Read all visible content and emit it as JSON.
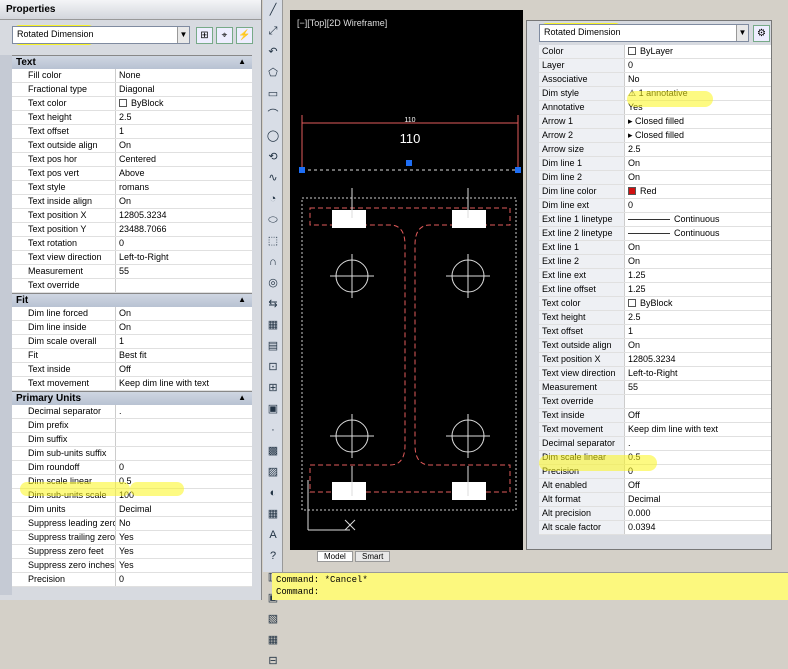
{
  "left_panel": {
    "title": "Properties",
    "combo": "Rotated Dimension",
    "sections": [
      {
        "name": "Text",
        "rows": [
          [
            "Fill color",
            "None"
          ],
          [
            "Fractional type",
            "Diagonal"
          ],
          [
            "Text color",
            "ByBlock"
          ],
          [
            "Text height",
            "2.5"
          ],
          [
            "Text offset",
            "1"
          ],
          [
            "Text outside align",
            "On"
          ],
          [
            "Text pos hor",
            "Centered"
          ],
          [
            "Text pos vert",
            "Above"
          ],
          [
            "Text style",
            "romans"
          ],
          [
            "Text inside align",
            "On"
          ],
          [
            "Text position X",
            "12805.3234"
          ],
          [
            "Text position Y",
            "23488.7066"
          ],
          [
            "Text rotation",
            "0"
          ],
          [
            "Text view direction",
            "Left-to-Right"
          ],
          [
            "Measurement",
            "55"
          ],
          [
            "Text override",
            ""
          ]
        ]
      },
      {
        "name": "Fit",
        "rows": [
          [
            "Dim line forced",
            "On"
          ],
          [
            "Dim line inside",
            "On"
          ],
          [
            "Dim scale overall",
            "1"
          ],
          [
            "Fit",
            "Best fit"
          ],
          [
            "Text inside",
            "Off"
          ],
          [
            "Text movement",
            "Keep dim line with text"
          ]
        ]
      },
      {
        "name": "Primary Units",
        "rows": [
          [
            "Decimal separator",
            "."
          ],
          [
            "Dim prefix",
            ""
          ],
          [
            "Dim suffix",
            ""
          ],
          [
            "Dim sub-units suffix",
            ""
          ],
          [
            "Dim roundoff",
            "0"
          ],
          [
            "Dim scale linear",
            "0.5"
          ],
          [
            "Dim sub-units scale",
            "100"
          ],
          [
            "Dim units",
            "Decimal"
          ],
          [
            "Suppress leading zeros",
            "No"
          ],
          [
            "Suppress trailing zeros",
            "Yes"
          ],
          [
            "Suppress zero feet",
            "Yes"
          ],
          [
            "Suppress zero inches",
            "Yes"
          ],
          [
            "Precision",
            "0"
          ]
        ]
      }
    ]
  },
  "viewport": {
    "label": "[−][Top][2D Wireframe]",
    "dim_small": "110",
    "dim_large": "110"
  },
  "right_panel": {
    "combo": "Rotated Dimension",
    "rows": [
      [
        "Color",
        "ByLayer"
      ],
      [
        "Layer",
        "0"
      ],
      [
        "Associative",
        "No"
      ],
      [
        "Dim style",
        "1 annotative"
      ],
      [
        "Annotative",
        "Yes"
      ],
      [
        "Arrow 1",
        "Closed filled"
      ],
      [
        "Arrow 2",
        "Closed filled"
      ],
      [
        "Arrow size",
        "2.5"
      ],
      [
        "Dim line 1",
        "On"
      ],
      [
        "Dim line 2",
        "On"
      ],
      [
        "Dim line color",
        "Red"
      ],
      [
        "Dim line ext",
        "0"
      ],
      [
        "Ext line 1 linetype",
        "Continuous"
      ],
      [
        "Ext line 2 linetype",
        "Continuous"
      ],
      [
        "Ext line 1",
        "On"
      ],
      [
        "Ext line 2",
        "On"
      ],
      [
        "Ext line ext",
        "1.25"
      ],
      [
        "Ext line offset",
        "1.25"
      ],
      [
        "Text color",
        "ByBlock"
      ],
      [
        "Text height",
        "2.5"
      ],
      [
        "Text offset",
        "1"
      ],
      [
        "Text outside align",
        "On"
      ],
      [
        "Text position X",
        "12805.3234"
      ],
      [
        "Text view direction",
        "Left-to-Right"
      ],
      [
        "Measurement",
        "55"
      ],
      [
        "Text override",
        ""
      ],
      [
        "Text inside",
        "Off"
      ],
      [
        "Text movement",
        "Keep dim line with text"
      ],
      [
        "Decimal separator",
        "."
      ],
      [
        "Dim scale linear",
        "0.5"
      ],
      [
        "Precision",
        "0"
      ],
      [
        "Alt enabled",
        "Off"
      ],
      [
        "Alt format",
        "Decimal"
      ],
      [
        "Alt precision",
        "0.000"
      ],
      [
        "Alt scale factor",
        "0.0394"
      ]
    ]
  },
  "tabs": {
    "model": "Model",
    "layout": "Smart"
  },
  "command": {
    "line1": "Command: *Cancel*",
    "line2": "Command:"
  }
}
